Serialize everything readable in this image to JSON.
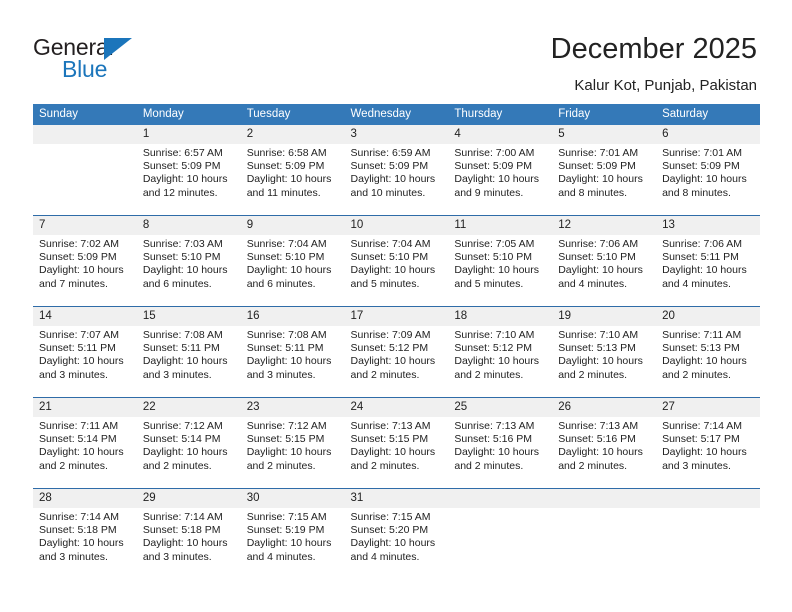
{
  "brand": {
    "name_part1": "General",
    "name_part2": "Blue",
    "triangle_color": "#1b75bb"
  },
  "header": {
    "title": "December 2025",
    "location": "Kalur Kot, Punjab, Pakistan"
  },
  "theme": {
    "header_bg": "#3479b8",
    "row_divider": "#2f6ca8",
    "daynum_bg": "#f0f0f0",
    "text": "#222222"
  },
  "weekday_headers": [
    "Sunday",
    "Monday",
    "Tuesday",
    "Wednesday",
    "Thursday",
    "Friday",
    "Saturday"
  ],
  "chart_data": {
    "type": "table",
    "title": "December 2025",
    "subtitle": "Kalur Kot, Punjab, Pakistan",
    "columns": [
      "Sunday",
      "Monday",
      "Tuesday",
      "Wednesday",
      "Thursday",
      "Friday",
      "Saturday"
    ],
    "weeks": [
      [
        {
          "day": "",
          "lines": []
        },
        {
          "day": "1",
          "lines": [
            "Sunrise: 6:57 AM",
            "Sunset: 5:09 PM",
            "Daylight: 10 hours",
            "and 12 minutes."
          ]
        },
        {
          "day": "2",
          "lines": [
            "Sunrise: 6:58 AM",
            "Sunset: 5:09 PM",
            "Daylight: 10 hours",
            "and 11 minutes."
          ]
        },
        {
          "day": "3",
          "lines": [
            "Sunrise: 6:59 AM",
            "Sunset: 5:09 PM",
            "Daylight: 10 hours",
            "and 10 minutes."
          ]
        },
        {
          "day": "4",
          "lines": [
            "Sunrise: 7:00 AM",
            "Sunset: 5:09 PM",
            "Daylight: 10 hours",
            "and 9 minutes."
          ]
        },
        {
          "day": "5",
          "lines": [
            "Sunrise: 7:01 AM",
            "Sunset: 5:09 PM",
            "Daylight: 10 hours",
            "and 8 minutes."
          ]
        },
        {
          "day": "6",
          "lines": [
            "Sunrise: 7:01 AM",
            "Sunset: 5:09 PM",
            "Daylight: 10 hours",
            "and 8 minutes."
          ]
        }
      ],
      [
        {
          "day": "7",
          "lines": [
            "Sunrise: 7:02 AM",
            "Sunset: 5:09 PM",
            "Daylight: 10 hours",
            "and 7 minutes."
          ]
        },
        {
          "day": "8",
          "lines": [
            "Sunrise: 7:03 AM",
            "Sunset: 5:10 PM",
            "Daylight: 10 hours",
            "and 6 minutes."
          ]
        },
        {
          "day": "9",
          "lines": [
            "Sunrise: 7:04 AM",
            "Sunset: 5:10 PM",
            "Daylight: 10 hours",
            "and 6 minutes."
          ]
        },
        {
          "day": "10",
          "lines": [
            "Sunrise: 7:04 AM",
            "Sunset: 5:10 PM",
            "Daylight: 10 hours",
            "and 5 minutes."
          ]
        },
        {
          "day": "11",
          "lines": [
            "Sunrise: 7:05 AM",
            "Sunset: 5:10 PM",
            "Daylight: 10 hours",
            "and 5 minutes."
          ]
        },
        {
          "day": "12",
          "lines": [
            "Sunrise: 7:06 AM",
            "Sunset: 5:10 PM",
            "Daylight: 10 hours",
            "and 4 minutes."
          ]
        },
        {
          "day": "13",
          "lines": [
            "Sunrise: 7:06 AM",
            "Sunset: 5:11 PM",
            "Daylight: 10 hours",
            "and 4 minutes."
          ]
        }
      ],
      [
        {
          "day": "14",
          "lines": [
            "Sunrise: 7:07 AM",
            "Sunset: 5:11 PM",
            "Daylight: 10 hours",
            "and 3 minutes."
          ]
        },
        {
          "day": "15",
          "lines": [
            "Sunrise: 7:08 AM",
            "Sunset: 5:11 PM",
            "Daylight: 10 hours",
            "and 3 minutes."
          ]
        },
        {
          "day": "16",
          "lines": [
            "Sunrise: 7:08 AM",
            "Sunset: 5:11 PM",
            "Daylight: 10 hours",
            "and 3 minutes."
          ]
        },
        {
          "day": "17",
          "lines": [
            "Sunrise: 7:09 AM",
            "Sunset: 5:12 PM",
            "Daylight: 10 hours",
            "and 2 minutes."
          ]
        },
        {
          "day": "18",
          "lines": [
            "Sunrise: 7:10 AM",
            "Sunset: 5:12 PM",
            "Daylight: 10 hours",
            "and 2 minutes."
          ]
        },
        {
          "day": "19",
          "lines": [
            "Sunrise: 7:10 AM",
            "Sunset: 5:13 PM",
            "Daylight: 10 hours",
            "and 2 minutes."
          ]
        },
        {
          "day": "20",
          "lines": [
            "Sunrise: 7:11 AM",
            "Sunset: 5:13 PM",
            "Daylight: 10 hours",
            "and 2 minutes."
          ]
        }
      ],
      [
        {
          "day": "21",
          "lines": [
            "Sunrise: 7:11 AM",
            "Sunset: 5:14 PM",
            "Daylight: 10 hours",
            "and 2 minutes."
          ]
        },
        {
          "day": "22",
          "lines": [
            "Sunrise: 7:12 AM",
            "Sunset: 5:14 PM",
            "Daylight: 10 hours",
            "and 2 minutes."
          ]
        },
        {
          "day": "23",
          "lines": [
            "Sunrise: 7:12 AM",
            "Sunset: 5:15 PM",
            "Daylight: 10 hours",
            "and 2 minutes."
          ]
        },
        {
          "day": "24",
          "lines": [
            "Sunrise: 7:13 AM",
            "Sunset: 5:15 PM",
            "Daylight: 10 hours",
            "and 2 minutes."
          ]
        },
        {
          "day": "25",
          "lines": [
            "Sunrise: 7:13 AM",
            "Sunset: 5:16 PM",
            "Daylight: 10 hours",
            "and 2 minutes."
          ]
        },
        {
          "day": "26",
          "lines": [
            "Sunrise: 7:13 AM",
            "Sunset: 5:16 PM",
            "Daylight: 10 hours",
            "and 2 minutes."
          ]
        },
        {
          "day": "27",
          "lines": [
            "Sunrise: 7:14 AM",
            "Sunset: 5:17 PM",
            "Daylight: 10 hours",
            "and 3 minutes."
          ]
        }
      ],
      [
        {
          "day": "28",
          "lines": [
            "Sunrise: 7:14 AM",
            "Sunset: 5:18 PM",
            "Daylight: 10 hours",
            "and 3 minutes."
          ]
        },
        {
          "day": "29",
          "lines": [
            "Sunrise: 7:14 AM",
            "Sunset: 5:18 PM",
            "Daylight: 10 hours",
            "and 3 minutes."
          ]
        },
        {
          "day": "30",
          "lines": [
            "Sunrise: 7:15 AM",
            "Sunset: 5:19 PM",
            "Daylight: 10 hours",
            "and 4 minutes."
          ]
        },
        {
          "day": "31",
          "lines": [
            "Sunrise: 7:15 AM",
            "Sunset: 5:20 PM",
            "Daylight: 10 hours",
            "and 4 minutes."
          ]
        },
        {
          "day": "",
          "lines": []
        },
        {
          "day": "",
          "lines": []
        },
        {
          "day": "",
          "lines": []
        }
      ]
    ]
  }
}
